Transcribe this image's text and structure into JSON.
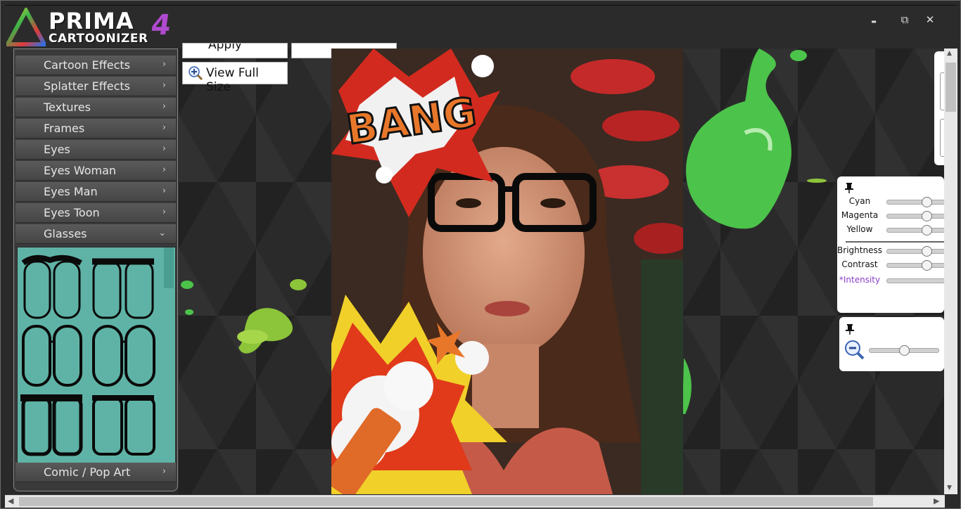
{
  "app": {
    "logo_top": "PRIMA",
    "logo_bottom": "CARTOONIZER",
    "logo_version": "4"
  },
  "window_controls": {
    "minimize": "▬",
    "maximize": "⧉",
    "close": "✕"
  },
  "toolbar": {
    "apply_label": "Apply",
    "view_full_size_label": "View Full Size"
  },
  "sidebar": {
    "items": [
      {
        "label": "Cartoon Effects",
        "chevron": "›"
      },
      {
        "label": "Splatter Effects",
        "chevron": "›"
      },
      {
        "label": "Textures",
        "chevron": "›"
      },
      {
        "label": "Frames",
        "chevron": "›"
      },
      {
        "label": "Eyes",
        "chevron": "›"
      },
      {
        "label": "Eyes Woman",
        "chevron": "›"
      },
      {
        "label": "Eyes Man",
        "chevron": "›"
      },
      {
        "label": "Eyes Toon",
        "chevron": "›"
      },
      {
        "label": "Glasses",
        "chevron": "⌄"
      }
    ],
    "bottom_item": {
      "label": "Comic / Pop Art",
      "chevron": "›"
    }
  },
  "canvas": {
    "comic_text": "BANG"
  },
  "adjust_panel": {
    "pin_icon": "pin-icon",
    "sliders": [
      {
        "label": "Cyan",
        "value": 0.5
      },
      {
        "label": "Magenta",
        "value": 0.5
      },
      {
        "label": "Yellow",
        "value": 0.5
      },
      {
        "label": "Brightness",
        "value": 0.5
      },
      {
        "label": "Contrast",
        "value": 0.5
      },
      {
        "label": "*Intensity",
        "value": 1.0
      }
    ]
  },
  "zoom_panel": {
    "zoom_value": 0.5
  },
  "colors": {
    "accent_purple": "#8a3fc7",
    "glasses_panel_bg": "#5fb3a6",
    "splatter_green": "#4cc34a"
  }
}
